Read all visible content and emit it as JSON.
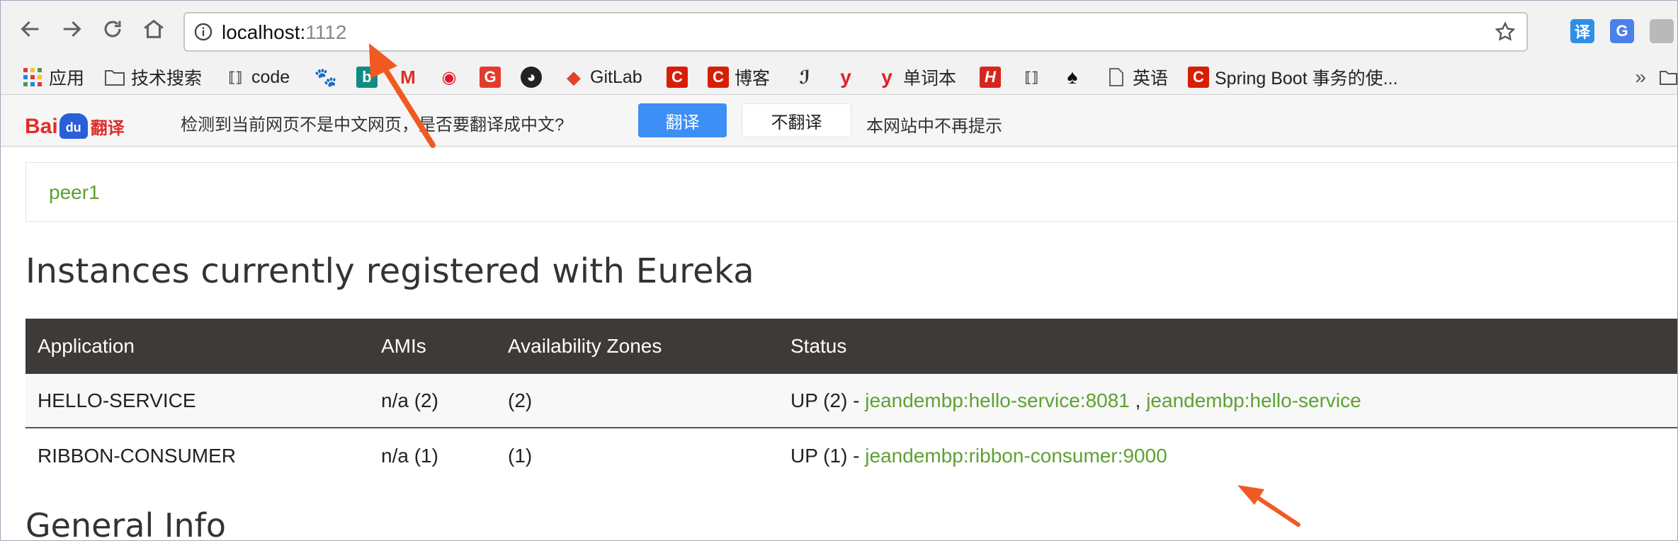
{
  "browser": {
    "url_host": "localhost:",
    "url_port": "1112",
    "extensions": [
      "translate-extension-icon",
      "google-translate-icon",
      "extension-icon"
    ]
  },
  "bookmarks": [
    {
      "label": "应用",
      "icon": "apps-grid-icon"
    },
    {
      "label": "技术搜索",
      "icon": "folder-icon"
    },
    {
      "label": "code",
      "icon": "link-icon"
    },
    {
      "label": "",
      "icon": "baidu-paw-icon"
    },
    {
      "label": "",
      "icon": "bing-icon"
    },
    {
      "label": "",
      "icon": "gmail-icon"
    },
    {
      "label": "",
      "icon": "weibo-icon"
    },
    {
      "label": "",
      "icon": "g-logo-icon"
    },
    {
      "label": "",
      "icon": "github-icon"
    },
    {
      "label": "GitLab",
      "icon": "gitlab-icon"
    },
    {
      "label": "",
      "icon": "csdn-icon"
    },
    {
      "label": "博客",
      "icon": "csdn-icon"
    },
    {
      "label": "",
      "icon": "script-icon"
    },
    {
      "label": "",
      "icon": "youdao-icon"
    },
    {
      "label": "单词本",
      "icon": "youdao-icon"
    },
    {
      "label": "",
      "icon": "h-icon"
    },
    {
      "label": "",
      "icon": "link-icon"
    },
    {
      "label": "",
      "icon": "spade-icon"
    },
    {
      "label": "英语",
      "icon": "page-icon"
    },
    {
      "label": "Spring Boot 事务的使...",
      "icon": "csdn-icon"
    }
  ],
  "bookmarks_more": "»",
  "translate_bar": {
    "logo_text": "Bai",
    "logo_paw": "du",
    "logo_suffix": "翻译",
    "message": "检测到当前网页不是中文网页，是否要翻译成中文?",
    "translate_button": "翻译",
    "no_translate_button": "不翻译",
    "never_link": "本网站中不再提示"
  },
  "page": {
    "peer_name": "peer1",
    "instances_heading": "Instances currently registered with Eureka",
    "table": {
      "headers": [
        "Application",
        "AMIs",
        "Availability Zones",
        "Status"
      ],
      "rows": [
        {
          "application": "HELLO-SERVICE",
          "amis": "n/a (2)",
          "zones": "(2)",
          "status_prefix": "UP (2) - ",
          "link1": "jeandembp:hello-service:8081",
          "sep": " , ",
          "link2": "jeandembp:hello-service"
        },
        {
          "application": "RIBBON-CONSUMER",
          "amis": "n/a (1)",
          "zones": "(1)",
          "status_prefix": "UP (1) - ",
          "link1": "jeandembp:ribbon-consumer:9000"
        }
      ]
    },
    "general_heading": "General Info"
  },
  "colors": {
    "accent_green": "#5ea132",
    "table_header": "#3d3a37",
    "annotation_arrow": "#f05a22",
    "translate_button": "#3d8ef5"
  }
}
